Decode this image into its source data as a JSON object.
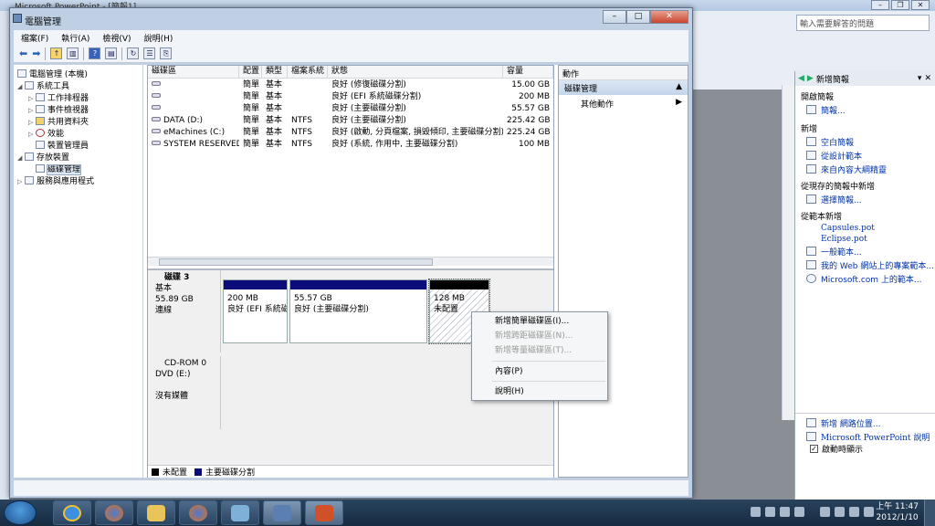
{
  "powerpoint": {
    "title": "Microsoft PowerPoint - [簡報1]",
    "help_placeholder": "輸入需要解答的問題",
    "taskpane": {
      "title": "新增簡報",
      "sections": [
        {
          "heading": "開啟簡報",
          "links": [
            "簡報..."
          ]
        },
        {
          "heading": "新增",
          "links": [
            "空白簡報",
            "從設計範本",
            "來自內容大綱精靈"
          ]
        },
        {
          "heading": "從現存的簡報中新增",
          "links": [
            "選擇簡報..."
          ]
        },
        {
          "heading": "從範本新增",
          "links": [
            "Capsules.pot",
            "Eclipse.pot",
            "一般範本...",
            "我的 Web 網站上的專案範本...",
            "Microsoft.com 上的範本..."
          ]
        }
      ],
      "bottom_links": [
        "新增 網路位置...",
        "Microsoft PowerPoint 說明"
      ],
      "show_on_startup": "啟動時顯示"
    }
  },
  "window": {
    "title": "電腦管理",
    "menu": [
      "檔案(F)",
      "執行(A)",
      "檢視(V)",
      "說明(H)"
    ],
    "tree": [
      {
        "label": "電腦管理 (本機)",
        "level": 0
      },
      {
        "label": "系統工具",
        "level": 1
      },
      {
        "label": "工作排程器",
        "level": 2
      },
      {
        "label": "事件檢視器",
        "level": 2
      },
      {
        "label": "共用資料夾",
        "level": 2
      },
      {
        "label": "效能",
        "level": 2
      },
      {
        "label": "裝置管理員",
        "level": 2
      },
      {
        "label": "存放裝置",
        "level": 1
      },
      {
        "label": "磁碟管理",
        "level": 2
      },
      {
        "label": "服務與應用程式",
        "level": 1
      }
    ],
    "volume_headers": [
      "磁碟區",
      "配置",
      "類型",
      "檔案系統",
      "狀態",
      "容量"
    ],
    "volumes": [
      [
        "",
        "簡單",
        "基本",
        "",
        "良好 (修復磁碟分割)",
        "15.00 GB"
      ],
      [
        "",
        "簡單",
        "基本",
        "",
        "良好 (EFI 系統磁碟分割)",
        "200 MB"
      ],
      [
        "",
        "簡單",
        "基本",
        "",
        "良好 (主要磁碟分割)",
        "55.57 GB"
      ],
      [
        "DATA (D:)",
        "簡單",
        "基本",
        "NTFS",
        "良好 (主要磁碟分割)",
        "225.42 GB"
      ],
      [
        "eMachines (C:)",
        "簡單",
        "基本",
        "NTFS",
        "良好 (啟動, 分頁檔案, 損毀傾印, 主要磁碟分割)",
        "225.24 GB"
      ],
      [
        "SYSTEM RESERVED",
        "簡單",
        "基本",
        "NTFS",
        "良好 (系統, 作用中, 主要磁碟分割)",
        "100 MB"
      ]
    ],
    "disk3": {
      "name": "磁碟 3",
      "type": "基本",
      "size": "55.89 GB",
      "status": "連線",
      "partitions": [
        {
          "size": "200 MB",
          "status": "良好 (EFI 系統磁"
        },
        {
          "size": "55.57 GB",
          "status": "良好 (主要磁碟分割)"
        },
        {
          "size": "128 MB",
          "status": "未配置"
        }
      ]
    },
    "cdrom": {
      "name": "CD-ROM 0",
      "drive": "DVD (E:)",
      "status": "沒有媒體"
    },
    "legend": [
      "未配置",
      "主要磁碟分割"
    ],
    "actions": {
      "header": "動作",
      "section": "磁碟管理",
      "item": "其他動作"
    }
  },
  "context_menu": [
    {
      "label": "新增簡單磁碟區(I)...",
      "enabled": true
    },
    {
      "label": "新增跨距磁碟區(N)...",
      "enabled": false
    },
    {
      "label": "新增等量磁碟區(T)...",
      "enabled": false
    },
    {
      "label": "內容(P)",
      "enabled": true
    },
    {
      "label": "說明(H)",
      "enabled": true
    }
  ],
  "taskbar": {
    "time": "上午 11:47",
    "date": "2012/1/10"
  }
}
